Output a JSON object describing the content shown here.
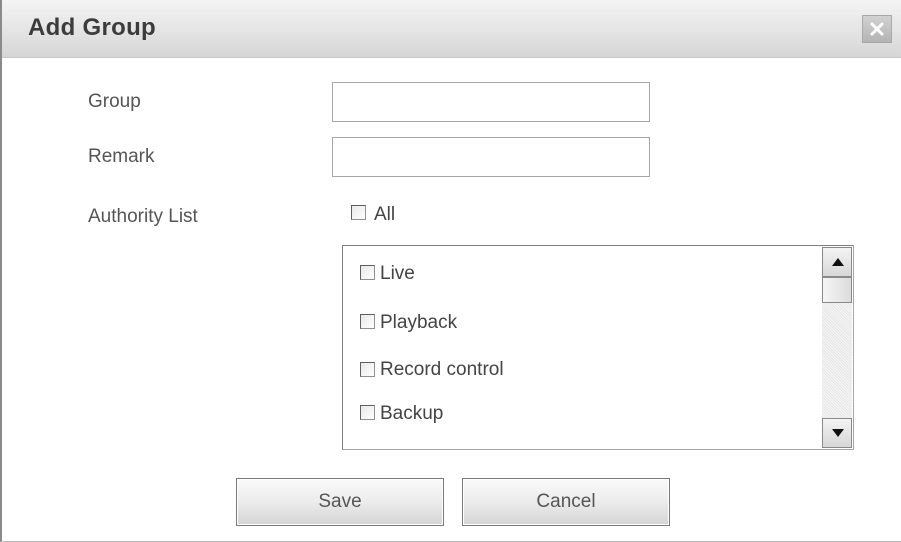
{
  "dialog": {
    "title": "Add Group",
    "close_icon": "close-icon"
  },
  "form": {
    "group_label": "Group",
    "group_value": "",
    "remark_label": "Remark",
    "remark_value": "",
    "authority_label": "Authority List",
    "all_label": "All",
    "all_checked": false
  },
  "authority_items": [
    {
      "label": "Live",
      "checked": false
    },
    {
      "label": "Playback",
      "checked": false
    },
    {
      "label": "Record control",
      "checked": false
    },
    {
      "label": "Backup",
      "checked": false
    }
  ],
  "buttons": {
    "save_label": "Save",
    "cancel_label": "Cancel"
  },
  "colors": {
    "title_text": "#3c3c3c",
    "label_text": "#555555",
    "close_button_bg": "#b4b4b4"
  }
}
